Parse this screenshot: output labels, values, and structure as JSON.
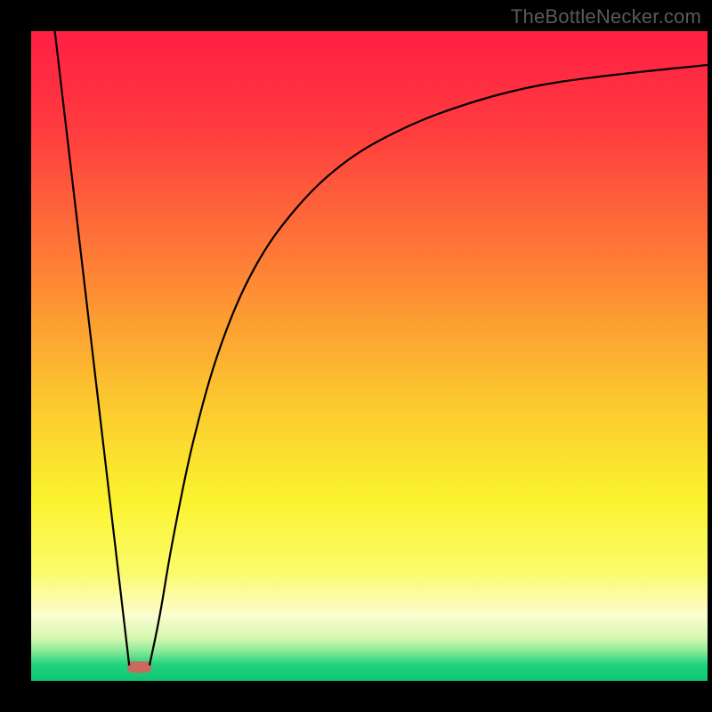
{
  "watermark": "TheBottleNecker.com",
  "chart_data": {
    "type": "line",
    "xlim": [
      0,
      100
    ],
    "ylim": [
      0,
      100
    ],
    "grid": false,
    "legend": false,
    "background_gradient": {
      "stops": [
        {
          "offset": 0.0,
          "color": "#ff1f43"
        },
        {
          "offset": 0.15,
          "color": "#ff3b3f"
        },
        {
          "offset": 0.35,
          "color": "#fe7c36"
        },
        {
          "offset": 0.55,
          "color": "#fcc22f"
        },
        {
          "offset": 0.72,
          "color": "#fbf32f"
        },
        {
          "offset": 0.83,
          "color": "#fbfb69"
        },
        {
          "offset": 0.9,
          "color": "#fcfccf"
        },
        {
          "offset": 0.935,
          "color": "#d4f7b0"
        },
        {
          "offset": 0.955,
          "color": "#86e897"
        },
        {
          "offset": 0.975,
          "color": "#20d47d"
        },
        {
          "offset": 1.0,
          "color": "#0fc474"
        }
      ]
    },
    "dip_region": {
      "x_start": 14.2,
      "x_end": 17.8,
      "y": 2.2,
      "color": "#c96a61"
    },
    "series": [
      {
        "name": "left-branch",
        "points": [
          {
            "x": 3.5,
            "y": 100
          },
          {
            "x": 14.5,
            "y": 2.4
          }
        ]
      },
      {
        "name": "right-branch",
        "points": [
          {
            "x": 17.5,
            "y": 2.4
          },
          {
            "x": 19.0,
            "y": 10.0
          },
          {
            "x": 21.0,
            "y": 22.0
          },
          {
            "x": 24.0,
            "y": 37.0
          },
          {
            "x": 28.0,
            "y": 51.5
          },
          {
            "x": 33.0,
            "y": 63.5
          },
          {
            "x": 39.0,
            "y": 72.5
          },
          {
            "x": 46.0,
            "y": 79.5
          },
          {
            "x": 54.0,
            "y": 84.5
          },
          {
            "x": 63.0,
            "y": 88.3
          },
          {
            "x": 73.0,
            "y": 91.2
          },
          {
            "x": 84.0,
            "y": 93.0
          },
          {
            "x": 100.0,
            "y": 94.8
          }
        ]
      }
    ]
  }
}
